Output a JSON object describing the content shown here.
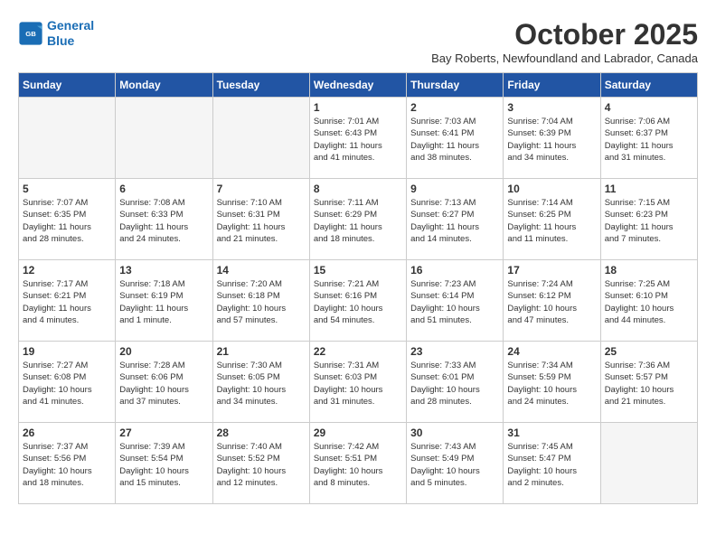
{
  "header": {
    "logo_line1": "General",
    "logo_line2": "Blue",
    "month": "October 2025",
    "location": "Bay Roberts, Newfoundland and Labrador, Canada"
  },
  "weekdays": [
    "Sunday",
    "Monday",
    "Tuesday",
    "Wednesday",
    "Thursday",
    "Friday",
    "Saturday"
  ],
  "weeks": [
    [
      {
        "day": "",
        "info": ""
      },
      {
        "day": "",
        "info": ""
      },
      {
        "day": "",
        "info": ""
      },
      {
        "day": "1",
        "info": "Sunrise: 7:01 AM\nSunset: 6:43 PM\nDaylight: 11 hours\nand 41 minutes."
      },
      {
        "day": "2",
        "info": "Sunrise: 7:03 AM\nSunset: 6:41 PM\nDaylight: 11 hours\nand 38 minutes."
      },
      {
        "day": "3",
        "info": "Sunrise: 7:04 AM\nSunset: 6:39 PM\nDaylight: 11 hours\nand 34 minutes."
      },
      {
        "day": "4",
        "info": "Sunrise: 7:06 AM\nSunset: 6:37 PM\nDaylight: 11 hours\nand 31 minutes."
      }
    ],
    [
      {
        "day": "5",
        "info": "Sunrise: 7:07 AM\nSunset: 6:35 PM\nDaylight: 11 hours\nand 28 minutes."
      },
      {
        "day": "6",
        "info": "Sunrise: 7:08 AM\nSunset: 6:33 PM\nDaylight: 11 hours\nand 24 minutes."
      },
      {
        "day": "7",
        "info": "Sunrise: 7:10 AM\nSunset: 6:31 PM\nDaylight: 11 hours\nand 21 minutes."
      },
      {
        "day": "8",
        "info": "Sunrise: 7:11 AM\nSunset: 6:29 PM\nDaylight: 11 hours\nand 18 minutes."
      },
      {
        "day": "9",
        "info": "Sunrise: 7:13 AM\nSunset: 6:27 PM\nDaylight: 11 hours\nand 14 minutes."
      },
      {
        "day": "10",
        "info": "Sunrise: 7:14 AM\nSunset: 6:25 PM\nDaylight: 11 hours\nand 11 minutes."
      },
      {
        "day": "11",
        "info": "Sunrise: 7:15 AM\nSunset: 6:23 PM\nDaylight: 11 hours\nand 7 minutes."
      }
    ],
    [
      {
        "day": "12",
        "info": "Sunrise: 7:17 AM\nSunset: 6:21 PM\nDaylight: 11 hours\nand 4 minutes."
      },
      {
        "day": "13",
        "info": "Sunrise: 7:18 AM\nSunset: 6:19 PM\nDaylight: 11 hours\nand 1 minute."
      },
      {
        "day": "14",
        "info": "Sunrise: 7:20 AM\nSunset: 6:18 PM\nDaylight: 10 hours\nand 57 minutes."
      },
      {
        "day": "15",
        "info": "Sunrise: 7:21 AM\nSunset: 6:16 PM\nDaylight: 10 hours\nand 54 minutes."
      },
      {
        "day": "16",
        "info": "Sunrise: 7:23 AM\nSunset: 6:14 PM\nDaylight: 10 hours\nand 51 minutes."
      },
      {
        "day": "17",
        "info": "Sunrise: 7:24 AM\nSunset: 6:12 PM\nDaylight: 10 hours\nand 47 minutes."
      },
      {
        "day": "18",
        "info": "Sunrise: 7:25 AM\nSunset: 6:10 PM\nDaylight: 10 hours\nand 44 minutes."
      }
    ],
    [
      {
        "day": "19",
        "info": "Sunrise: 7:27 AM\nSunset: 6:08 PM\nDaylight: 10 hours\nand 41 minutes."
      },
      {
        "day": "20",
        "info": "Sunrise: 7:28 AM\nSunset: 6:06 PM\nDaylight: 10 hours\nand 37 minutes."
      },
      {
        "day": "21",
        "info": "Sunrise: 7:30 AM\nSunset: 6:05 PM\nDaylight: 10 hours\nand 34 minutes."
      },
      {
        "day": "22",
        "info": "Sunrise: 7:31 AM\nSunset: 6:03 PM\nDaylight: 10 hours\nand 31 minutes."
      },
      {
        "day": "23",
        "info": "Sunrise: 7:33 AM\nSunset: 6:01 PM\nDaylight: 10 hours\nand 28 minutes."
      },
      {
        "day": "24",
        "info": "Sunrise: 7:34 AM\nSunset: 5:59 PM\nDaylight: 10 hours\nand 24 minutes."
      },
      {
        "day": "25",
        "info": "Sunrise: 7:36 AM\nSunset: 5:57 PM\nDaylight: 10 hours\nand 21 minutes."
      }
    ],
    [
      {
        "day": "26",
        "info": "Sunrise: 7:37 AM\nSunset: 5:56 PM\nDaylight: 10 hours\nand 18 minutes."
      },
      {
        "day": "27",
        "info": "Sunrise: 7:39 AM\nSunset: 5:54 PM\nDaylight: 10 hours\nand 15 minutes."
      },
      {
        "day": "28",
        "info": "Sunrise: 7:40 AM\nSunset: 5:52 PM\nDaylight: 10 hours\nand 12 minutes."
      },
      {
        "day": "29",
        "info": "Sunrise: 7:42 AM\nSunset: 5:51 PM\nDaylight: 10 hours\nand 8 minutes."
      },
      {
        "day": "30",
        "info": "Sunrise: 7:43 AM\nSunset: 5:49 PM\nDaylight: 10 hours\nand 5 minutes."
      },
      {
        "day": "31",
        "info": "Sunrise: 7:45 AM\nSunset: 5:47 PM\nDaylight: 10 hours\nand 2 minutes."
      },
      {
        "day": "",
        "info": ""
      }
    ]
  ]
}
